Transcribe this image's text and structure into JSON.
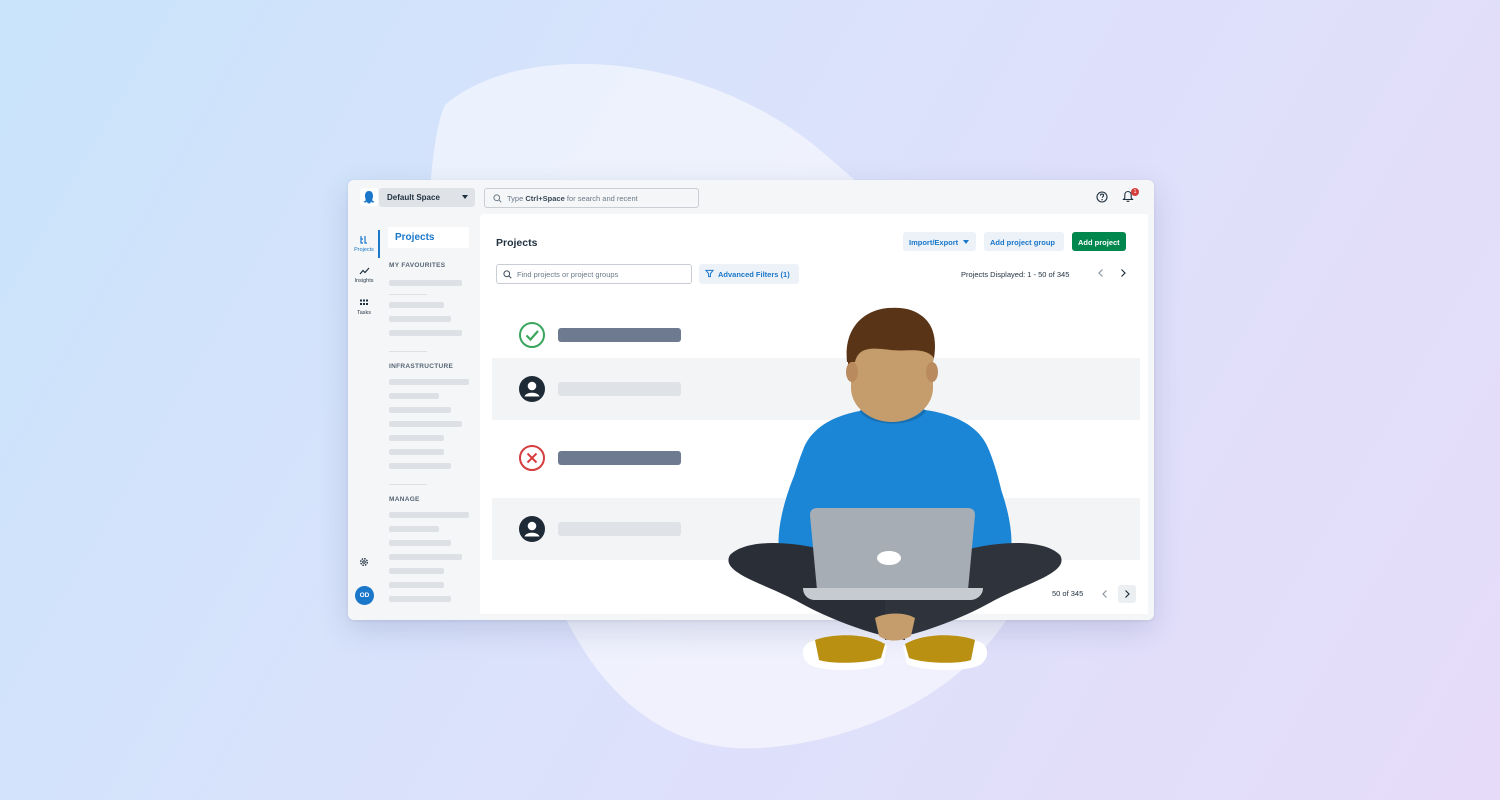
{
  "colors": {
    "accent": "#1a77ca",
    "primary_button": "#00874d",
    "success": "#3aa55d",
    "error": "#d63d3d",
    "badge": "#d63d3d"
  },
  "topbar": {
    "space_name": "Default Space",
    "search_prefix": "Type",
    "search_shortcut": "Ctrl+Space",
    "search_suffix": "for search and recent",
    "help_icon": "question-circle-icon",
    "notification_icon": "bell-icon",
    "notification_count": "1"
  },
  "rail": {
    "items": [
      {
        "label": "Projects",
        "icon": "projects-icon",
        "active": true
      },
      {
        "label": "Insights",
        "icon": "insights-icon",
        "active": false
      },
      {
        "label": "Tasks",
        "icon": "tasks-icon",
        "active": false
      }
    ],
    "settings_icon": "gear-icon",
    "avatar_initials": "OD"
  },
  "sidenav": {
    "title": "Projects",
    "sections": [
      "MY FAVOURITES",
      "INFRASTRUCTURE",
      "MANAGE"
    ]
  },
  "main": {
    "title": "Projects",
    "import_export_label": "Import/Export",
    "add_group_label": "Add project group",
    "add_project_label": "Add project",
    "find_placeholder": "Find projects or project groups",
    "filters_label": "Advanced Filters (1)",
    "displayed_label": "Projects Displayed: 1 - 50 of 345",
    "footer_count": "50 of 345",
    "rows": [
      {
        "status": "success",
        "status_icon": "check-circle-icon"
      },
      {
        "status": "neutral",
        "status_icon": "user-circle-icon"
      },
      {
        "status": "failed",
        "status_icon": "x-circle-icon"
      },
      {
        "status": "neutral",
        "status_icon": "user-circle-icon"
      }
    ]
  }
}
